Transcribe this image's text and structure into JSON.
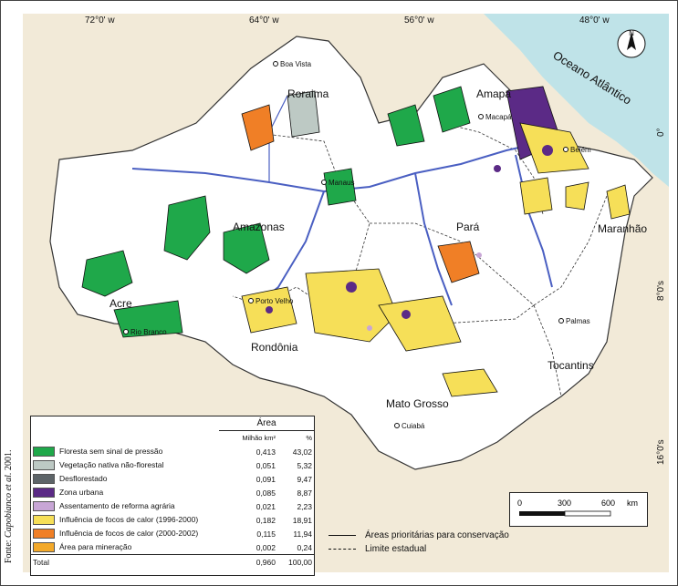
{
  "coordinates": {
    "top": [
      "72°0' w",
      "64°0' w",
      "56°0' w",
      "48°0' w"
    ],
    "right": [
      "0°",
      "8°0's",
      "16°0's"
    ]
  },
  "states": [
    "Roraima",
    "Amapá",
    "Amazonas",
    "Pará",
    "Maranhão",
    "Rondônia",
    "Tocantins",
    "Mato Grosso",
    "Acre"
  ],
  "cities": [
    "Boa Vista",
    "Macapá",
    "Belém",
    "Manaus",
    "Porto Velho",
    "Palmas",
    "Cuiabá",
    "Rio Branco"
  ],
  "ocean_label": "Oceano Atlântico",
  "north_arrow": "N",
  "legend": {
    "header_area": "Área",
    "header_units": "Milhão km²",
    "header_percent": "%",
    "items": [
      {
        "label": "Floresta sem sinal de pressão",
        "value": "0,413",
        "percent": "43,02",
        "color": "#1fa84a"
      },
      {
        "label": "Vegetação nativa não-florestal",
        "value": "0,051",
        "percent": "5,32",
        "color": "#bdc9c4"
      },
      {
        "label": "Desflorestado",
        "value": "0,091",
        "percent": "9,47",
        "color": "#5d6468"
      },
      {
        "label": "Zona urbana",
        "value": "0,085",
        "percent": "8,87",
        "color": "#5b2a86"
      },
      {
        "label": "Assentamento de reforma agrária",
        "value": "0,021",
        "percent": "2,23",
        "color": "#c8a6d6"
      },
      {
        "label": "Influência de focos de calor (1996-2000)",
        "value": "0,182",
        "percent": "18,91",
        "color": "#f6df58"
      },
      {
        "label": "Influência de focos de calor (2000-2002)",
        "value": "0,115",
        "percent": "11,94",
        "color": "#f07f26"
      },
      {
        "label": "Área para mineração",
        "value": "0,002",
        "percent": "0,24",
        "color": "#f3a92a"
      }
    ],
    "total_label": "Total",
    "total_value": "0,960",
    "total_percent": "100,00"
  },
  "line_legend": {
    "priority": "Áreas prioritárias para conservação",
    "boundary": "Limite estadual"
  },
  "scale": {
    "labels": [
      "0",
      "300",
      "600"
    ],
    "unit": "km"
  },
  "source": {
    "prefix": "Fonte: ",
    "author": "Capobianco et al.",
    "year": " 2001."
  }
}
